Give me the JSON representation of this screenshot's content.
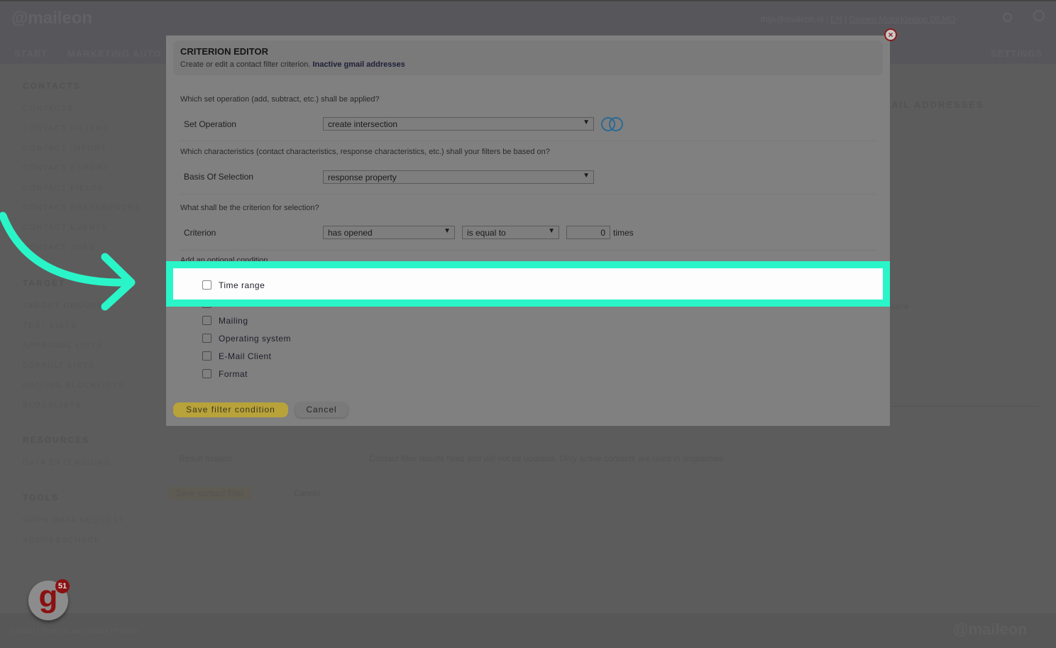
{
  "header": {
    "logo": "@maileon",
    "user_email": "thijs@maileon.nl",
    "language": "EN",
    "account": "Damen Motorkleding DEMO",
    "nav": [
      "START",
      "MARKETING AUTO",
      "SETTINGS"
    ]
  },
  "sidebar": {
    "sections": [
      {
        "title": "CONTACTS",
        "items": [
          "CONTACTS",
          "CONTACT FILTERS",
          "CONTACT IMPORT",
          "CONTACT EXPORT",
          "CONTACT FIELDS",
          "CONTACT PREFERENCES",
          "CONTACT EVENTS",
          "CONTACT JOBS"
        ]
      },
      {
        "title": "TARGET",
        "items": [
          "TARGET GROUPS",
          "TEST LISTS",
          "APPROVAL LISTS",
          "DEFAULT LISTS",
          "MAILING BLOCKLISTS",
          "BLOCKLISTS"
        ]
      },
      {
        "title": "RESOURCES",
        "items": [
          "DATA EXTENSIONS"
        ]
      },
      {
        "title": "TOOLS",
        "items": [
          "GDPR DATA REQUEST",
          "ADDRESSCHECK"
        ]
      }
    ]
  },
  "background": {
    "page_title_fragment": "AIL ADDRESSES",
    "score_label": "core",
    "result_fixation_label": "Result fixation",
    "result_fixation_text": "Contact filter results fixed and will not be updated. Only active contacts are used in dispatches",
    "save_button": "Save contact filter",
    "cancel_button": "Cancel",
    "footer_links": "Contact | Terms of use | Imprint | Privacy",
    "footer_logo": "@maileon",
    "badge_count": "51"
  },
  "modal": {
    "title": "CRITERION EDITOR",
    "subtitle": "Create or edit a contact filter criterion.",
    "filter_name": "Inactive gmail addresses",
    "q_set_operation": "Which set operation (add, subtract, etc.) shall be applied?",
    "set_operation_label": "Set Operation",
    "set_operation_value": "create intersection",
    "q_basis": "Which characteristics (contact characteristics, response characteristics, etc.) shall your filters be based on?",
    "basis_label": "Basis Of Selection",
    "basis_value": "response property",
    "q_criterion": "What shall be the criterion for selection?",
    "criterion_label": "Criterion",
    "criterion_value": "has opened",
    "comparator_value": "is equal to",
    "count_value": "0",
    "count_unit": "times",
    "optional_condition_heading": "Add an optional condition",
    "conditions": [
      {
        "label": "Time range",
        "checked": false
      },
      {
        "label": "Mailing",
        "checked": false
      },
      {
        "label": "Operating system",
        "checked": false
      },
      {
        "label": "E-Mail Client",
        "checked": false
      },
      {
        "label": "Format",
        "checked": false
      }
    ],
    "save_button": "Save filter condition",
    "cancel_button": "Cancel"
  },
  "colors": {
    "highlight": "#2af5c8",
    "save_button": "#b8a23a",
    "close_icon": "#8b1a1a"
  }
}
